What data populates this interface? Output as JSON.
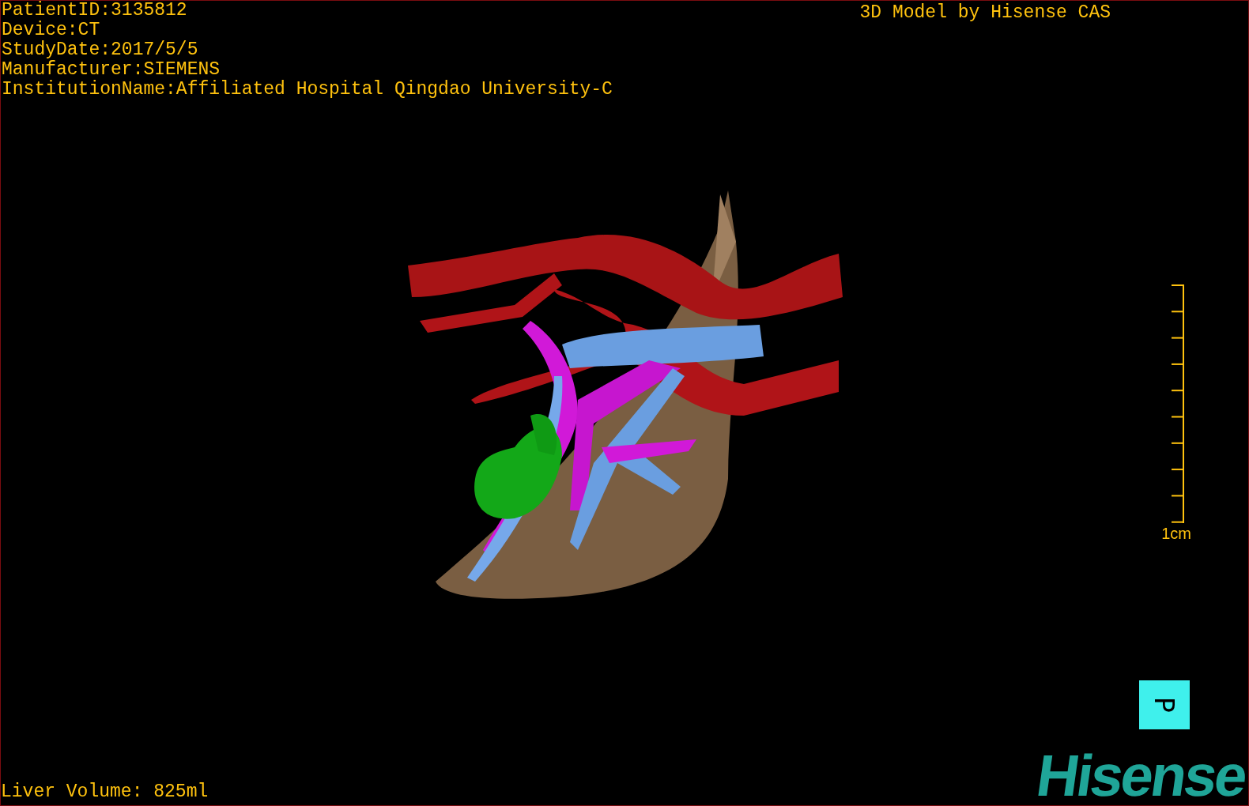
{
  "patient_info": [
    "PatientID:3135812",
    "Device:CT",
    "StudyDate:2017/5/5",
    "Manufacturer:SIEMENS",
    "InstitutionName:Affiliated Hospital Qingdao University-C"
  ],
  "title": "3D Model by Hisense CAS",
  "scale_label": "1cm",
  "orientation_label": "P",
  "liver_volume": "Liver Volume: 825ml",
  "logo": "Hisense"
}
